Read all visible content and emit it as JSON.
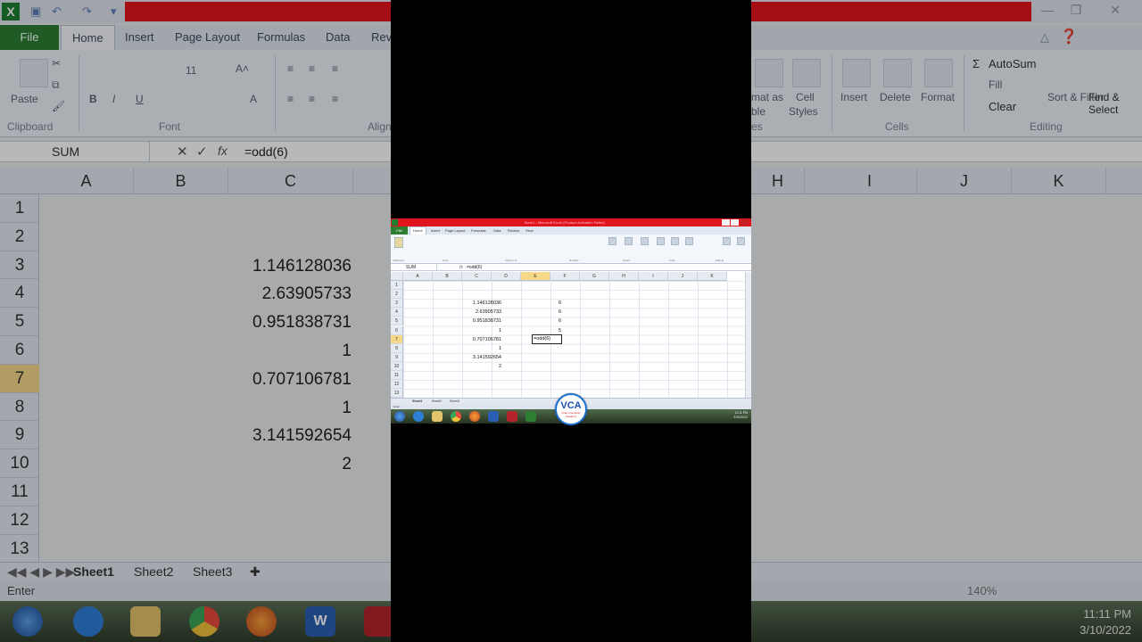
{
  "app": {
    "window_title": "Book1 - Microsoft Excel (Product Activation Failed)"
  },
  "ribbon": {
    "file_label": "File",
    "tabs": [
      "Home",
      "Insert",
      "Page Layout",
      "Formulas",
      "Data",
      "Review",
      "View"
    ],
    "active_tab": "Home",
    "groups": [
      "Clipboard",
      "Font",
      "Alignment",
      "Number",
      "Styles",
      "Cells",
      "Editing"
    ],
    "paste_label": "Paste",
    "font_size": "11",
    "number_format": "General",
    "insert_label": "Insert",
    "delete_label": "Delete",
    "format_label": "Format",
    "autosum_label": "AutoSum",
    "fill_label": "Fill",
    "clear_label": "Clear",
    "sort_filter_label": "Sort & Filter",
    "find_select_label": "Find & Select",
    "bg_styles_fragment_1": "mat as",
    "bg_styles_fragment_2": "ble",
    "bg_cell_styles_1": "Cell",
    "bg_cell_styles_2": "Styles",
    "bg_styles_group_fragment": "es",
    "bg_alignment_fragment": "Align",
    "bg_tab_fragment": "Rev"
  },
  "formula_bar": {
    "name_box": "SUM",
    "formula": "=odd(6)",
    "fx_label": "fx"
  },
  "grid": {
    "columns": [
      "A",
      "B",
      "C",
      "D",
      "E",
      "F",
      "G",
      "H",
      "I",
      "J",
      "K"
    ],
    "bg_visible_columns": [
      "A",
      "B",
      "C",
      "H",
      "I",
      "J",
      "K"
    ],
    "rows": [
      "1",
      "2",
      "3",
      "4",
      "5",
      "6",
      "7",
      "8",
      "9",
      "10",
      "11",
      "12",
      "13"
    ],
    "active_row": "7",
    "active_column": "E",
    "column_c_values": [
      "1.146128036",
      "2.63905733",
      "0.951838731",
      "1",
      "0.707106781",
      "1",
      "3.141592654",
      "2"
    ],
    "column_c_start_row": 3,
    "column_e_values": [
      "6",
      "6",
      "6",
      "5"
    ],
    "column_e_start_row": 3,
    "active_cell_text": "=odd(6)"
  },
  "sheets": [
    "Sheet1",
    "Sheet2",
    "Sheet3"
  ],
  "active_sheet": "Sheet1",
  "status": {
    "mode": "Enter",
    "zoom": "140%"
  },
  "taskbar": {
    "time": "11:11 PM",
    "date": "3/10/2022",
    "icons": [
      "start-orb-icon",
      "internet-explorer-icon",
      "file-explorer-icon",
      "chrome-icon",
      "firefox-icon",
      "word-icon",
      "screen-recorder-icon",
      "excel-icon"
    ]
  },
  "overlay_logo": {
    "text": "VCA",
    "subtitle": "Vinay Computer Academy"
  },
  "colors": {
    "title_red": "#e3141c",
    "file_green": "#2d7d33",
    "selection_yellow": "#f6d889"
  }
}
